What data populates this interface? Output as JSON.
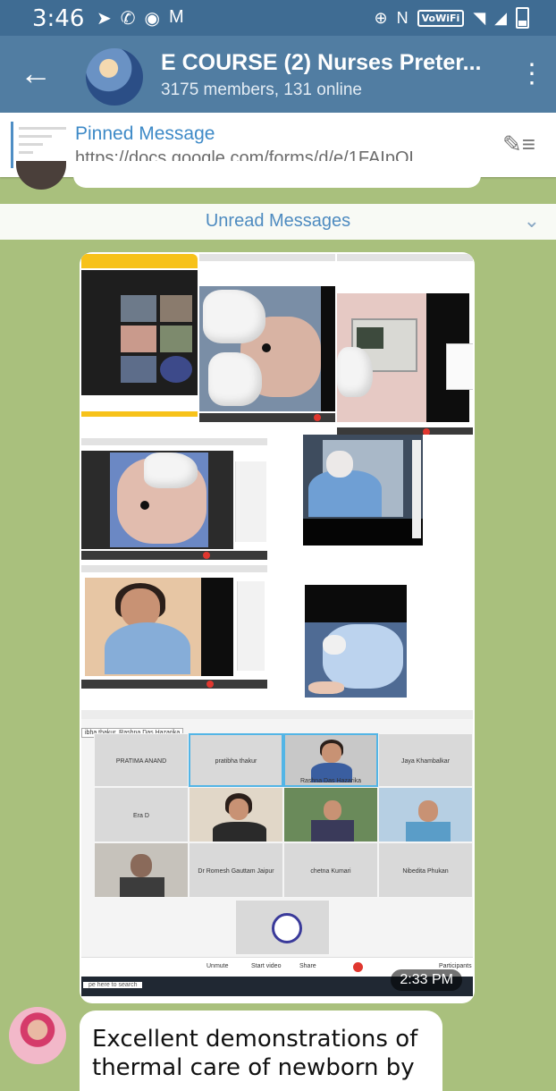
{
  "status_bar": {
    "time": "3:46",
    "network_label": "VoWiFi",
    "left_icons": [
      "telegram-icon",
      "phone-icon",
      "circle-app-icon",
      "gmail-icon"
    ],
    "right_icons": [
      "data-saver-icon",
      "nfc-icon",
      "vowifi-icon",
      "wifi-icon",
      "signal-icon",
      "battery-icon"
    ]
  },
  "header": {
    "title": "E COURSE (2) Nurses Preter...",
    "subtitle": "3175 members, 131 online"
  },
  "pinned": {
    "title": "Pinned Message",
    "url": "https://docs.google.com/forms/d/e/1FAIpQL..."
  },
  "unread": {
    "label": "Unread Messages"
  },
  "media": {
    "time": "2:33 PM",
    "participant_grid": {
      "banner": "ibha thakur, Rashna Das Hazarika",
      "cells": [
        "PRATIMA ANAND",
        "pratibha thakur",
        "Rashna Das Hazarika",
        "Jaya Khambalkar",
        "Era D",
        "",
        "",
        "",
        "",
        "Dr Romesh Gauttam Jaipur",
        "chetna Kumari",
        "Nibedita Phukan"
      ],
      "toolbar_items": [
        "Unmute",
        "Start video",
        "Share",
        "Participants"
      ],
      "search_hint": "pe here to search"
    }
  },
  "message": {
    "text_line1": "Excellent demonstrations of",
    "text_line2": "thermal care of newborn by"
  }
}
